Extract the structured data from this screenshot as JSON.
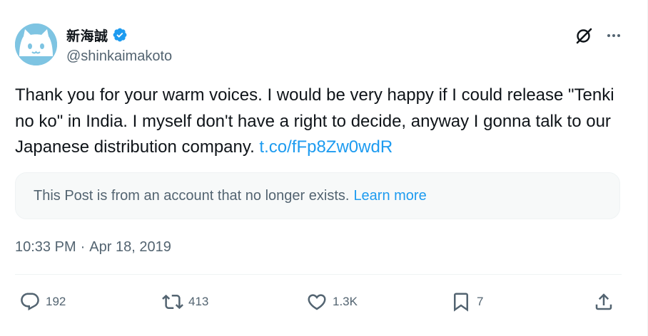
{
  "user": {
    "display_name": "新海誠",
    "handle": "@shinkaimakoto",
    "avatar_icon": "cat-face-avatar",
    "verified_icon": "verified-badge-icon"
  },
  "header_actions": {
    "grok_icon": "grok-icon",
    "more_icon": "more-options-icon"
  },
  "tweet": {
    "text": "Thank you for your warm voices. I would be very happy if I could release \"Tenki no ko\" in India. I myself don't have a right to decide, anyway I gonna talk to our Japanese distribution company. ",
    "link": "t.co/fFp8Zw0wdR"
  },
  "notice": {
    "text": "This Post is from an account that no longer exists.",
    "learn_more": "Learn more"
  },
  "meta": {
    "time": "10:33 PM",
    "separator": "·",
    "date": "Apr 18, 2019"
  },
  "actions": {
    "replies": "192",
    "reposts": "413",
    "likes": "1.3K",
    "bookmarks": "7"
  },
  "colors": {
    "accent": "#1d9bf0",
    "secondary_text": "#536471",
    "primary_text": "#0f1419",
    "avatar_bg": "#7ec4e2"
  }
}
